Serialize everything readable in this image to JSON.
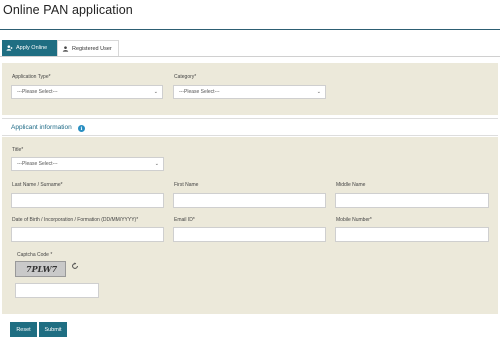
{
  "page": {
    "title": "Online PAN application"
  },
  "tabs": {
    "apply_online": "Apply Online",
    "registered_user": "Registered User"
  },
  "row1": {
    "application_type_label": "Application Type*",
    "application_type_value": "---Please Select---",
    "category_label": "Category*",
    "category_value": "---Please Select---"
  },
  "applicant": {
    "section_title": "Applicant information",
    "info_icon": "i",
    "title_label": "Title*",
    "title_value": "---Please Select---",
    "last_name_label": "Last Name / Surname*",
    "first_name_label": "First Name",
    "middle_name_label": "Middle Name",
    "dob_label": "Date of Birth / Incorporation / Formation (DD/MM/YYYY)*",
    "email_label": "Email ID*",
    "mobile_label": "Mobile Number*"
  },
  "captcha": {
    "label": "Captcha Code *",
    "code": "7PLW7",
    "input_value": ""
  },
  "buttons": {
    "reset": "Reset",
    "submit": "Submit"
  },
  "colors": {
    "primary": "#1f6e82",
    "panel": "#ece9da",
    "link": "#1e6a86"
  }
}
